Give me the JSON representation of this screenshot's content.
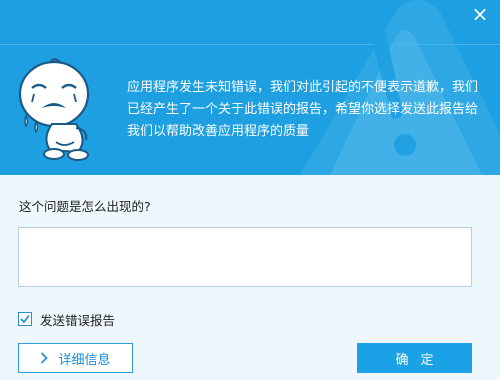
{
  "dialog": {
    "close_glyph": "×",
    "message": "应用程序发生未知错误，我们对此引起的不便表示道歉，我们已经产生了一个关于此错误的报告，希望你选择发送此报告给我们以帮助改善应用程序的质量",
    "question": "这个问题是怎么出现的?",
    "description_value": "",
    "send_report_label": "发送错误报告",
    "send_report_checked": true,
    "details_button_label": "详细信息",
    "ok_button_label": "确定"
  },
  "icons": {
    "close": "close-icon",
    "mascot": "crying-mascot-icon",
    "warning_bg": "warning-triangle-icon",
    "checkbox": "checkmark-icon",
    "details": "chevron-right-icon"
  },
  "colors": {
    "banner": "#1e9fe1",
    "body_bg": "#eef7fc",
    "accent": "#1aa1e6",
    "details_border": "#2d9ae0"
  }
}
